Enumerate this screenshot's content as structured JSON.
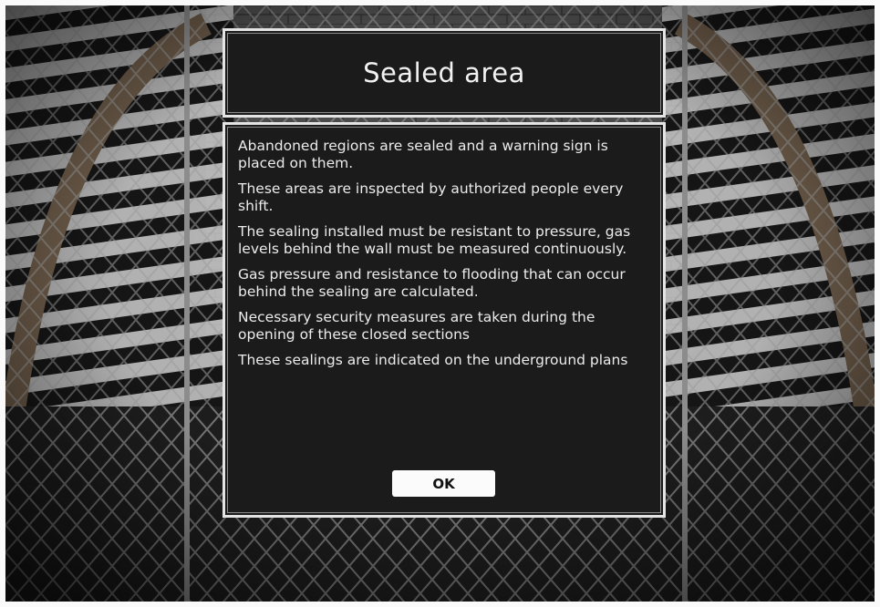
{
  "dialog": {
    "title": "Sealed area",
    "paragraphs": [
      "Abandoned regions are sealed and a warning sign is placed on them.",
      "These areas are inspected by authorized people every shift.",
      "The sealing installed must be resistant to pressure, gas levels behind the wall must be measured continuously.",
      "Gas pressure and resistance to flooding that can occur behind the sealing are calculated.",
      "Necessary security measures are taken during the opening of these closed sections",
      "These sealings are indicated on the underground plans"
    ],
    "ok_label": "OK"
  },
  "colors": {
    "panel_background": "#1b1b1b",
    "panel_border": "#e4e4e4",
    "text": "#ececec",
    "button_background": "#fbfbfb"
  }
}
